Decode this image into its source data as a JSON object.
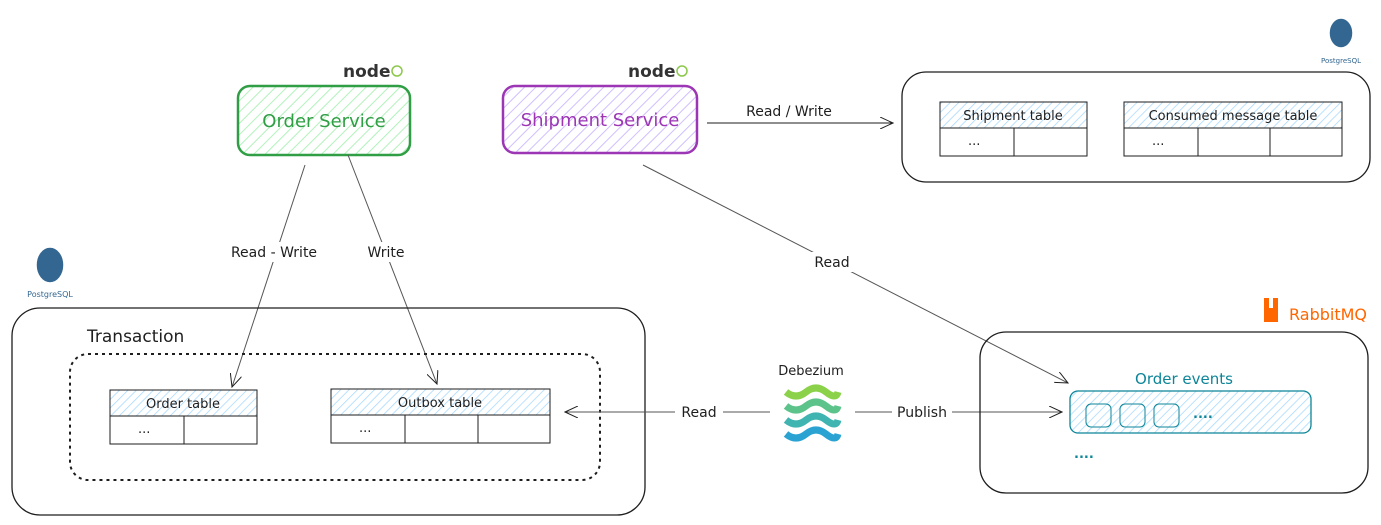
{
  "services": {
    "order": {
      "label": "Order Service",
      "runtime_logo": "node",
      "color": "#2f9e44"
    },
    "shipment": {
      "label": "Shipment Service",
      "runtime_logo": "node",
      "color": "#9c36b5"
    }
  },
  "logos": {
    "node": "node",
    "postgres": "PostgreSQL",
    "rabbitmq": "RabbitMQ"
  },
  "shipment_db": {
    "tables": [
      {
        "name": "Shipment table",
        "cells": [
          "...",
          ""
        ]
      },
      {
        "name": "Consumed message table",
        "cells": [
          "...",
          "",
          ""
        ]
      }
    ]
  },
  "order_db": {
    "transaction_label": "Transaction",
    "tables": [
      {
        "name": "Order table",
        "cells": [
          "...",
          ""
        ]
      },
      {
        "name": "Outbox table",
        "cells": [
          "...",
          "",
          ""
        ]
      }
    ]
  },
  "debezium": {
    "label": "Debezium"
  },
  "broker": {
    "queue_label": "Order events",
    "queue_more": "....",
    "more": "....",
    "color": "#0c8599"
  },
  "arrows": {
    "shipment_db_rw": "Read / Write",
    "shipment_read_queue": "Read",
    "order_read_write": "Read - Write",
    "order_write_outbox": "Write",
    "debezium_read": "Read",
    "debezium_publish": "Publish"
  }
}
